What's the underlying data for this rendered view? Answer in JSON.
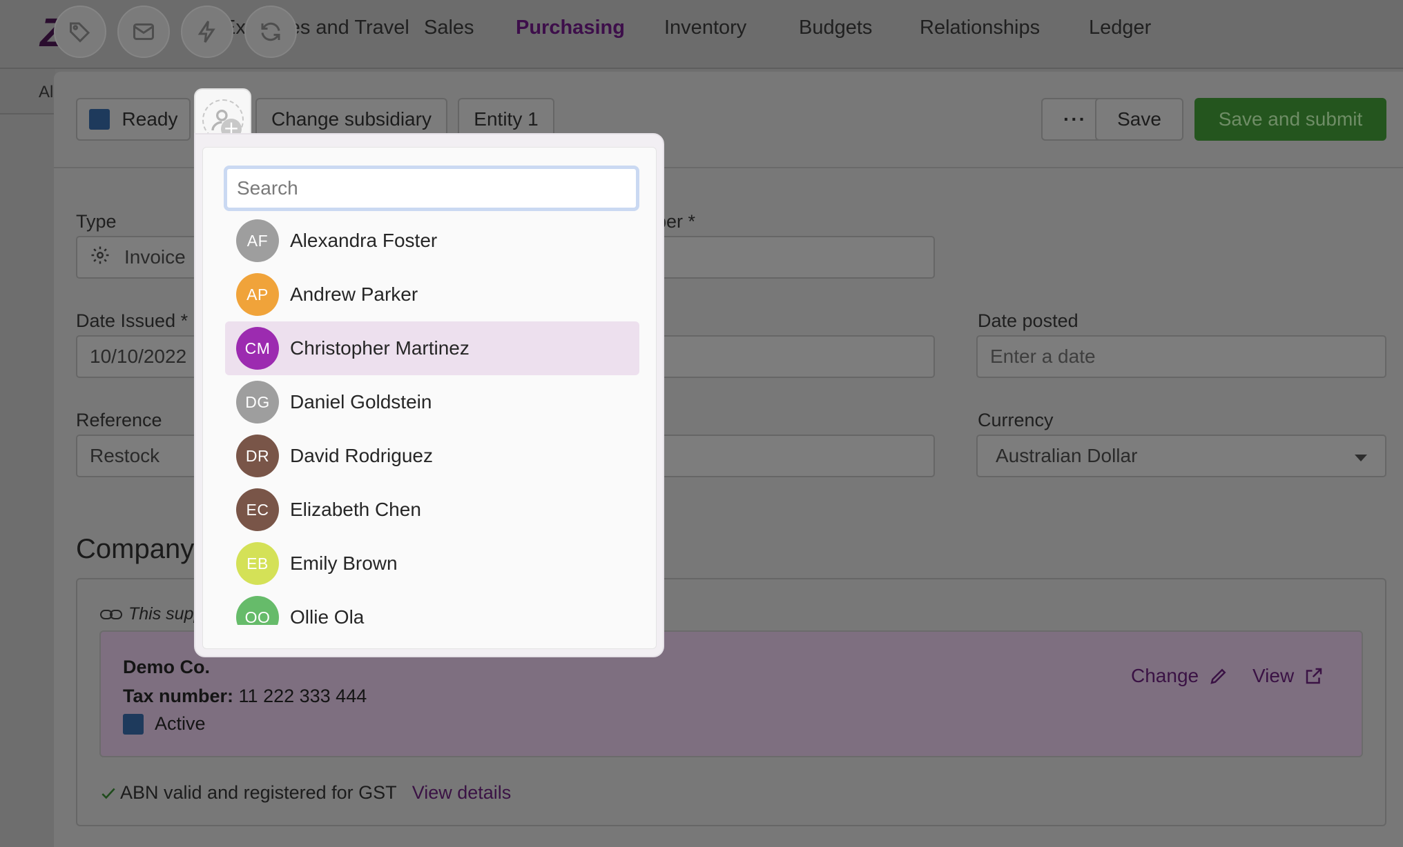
{
  "nav": {
    "logo": "Ze",
    "items": [
      {
        "label": "Expenses and Travel",
        "active": false
      },
      {
        "label": "Sales",
        "active": false
      },
      {
        "label": "Purchasing",
        "active": true
      },
      {
        "label": "Inventory",
        "active": false
      },
      {
        "label": "Budgets",
        "active": false
      },
      {
        "label": "Relationships",
        "active": false
      },
      {
        "label": "Ledger",
        "active": false
      }
    ],
    "quick_icons": [
      "tag-icon",
      "mail-icon",
      "lightning-icon",
      "refresh-icon"
    ]
  },
  "subnav": {
    "label": "Al"
  },
  "toolbar": {
    "status_label": "Ready",
    "change_subsidiary_label": "Change subsidiary",
    "entity_label": "Entity 1",
    "more_label": "···",
    "save_label": "Save",
    "save_submit_label": "Save and submit"
  },
  "form": {
    "type_label": "Type",
    "type_value": "Invoice",
    "number_label": "ber *",
    "date_issued_label": "Date Issued *",
    "date_issued_value": "10/10/2022",
    "date_posted_label": "Date posted",
    "date_posted_placeholder": "Enter a date",
    "reference_label": "Reference",
    "reference_value": "Restock",
    "currency_label": "Currency",
    "currency_value": "Australian Dollar"
  },
  "company": {
    "title": "Company",
    "note": "This supp",
    "supplier_name": "Demo Co.",
    "tax_label": "Tax number:",
    "tax_value": "11 222 333 444",
    "status": "Active",
    "change_label": "Change",
    "view_label": "View",
    "abn_text": "ABN valid and registered for GST",
    "view_details_label": "View details"
  },
  "assignee_dropdown": {
    "search_placeholder": "Search",
    "people": [
      {
        "initials": "AF",
        "name": "Alexandra Foster",
        "color": "#9e9e9e",
        "highlighted": false
      },
      {
        "initials": "AP",
        "name": "Andrew Parker",
        "color": "#f0a33a",
        "highlighted": false
      },
      {
        "initials": "CM",
        "name": "Christopher Martinez",
        "color": "#9c2bb0",
        "highlighted": true
      },
      {
        "initials": "DG",
        "name": "Daniel Goldstein",
        "color": "#9e9e9e",
        "highlighted": false
      },
      {
        "initials": "DR",
        "name": "David Rodriguez",
        "color": "#795548",
        "highlighted": false
      },
      {
        "initials": "EC",
        "name": "Elizabeth Chen",
        "color": "#795548",
        "highlighted": false
      },
      {
        "initials": "EB",
        "name": "Emily Brown",
        "color": "#d4e157",
        "highlighted": false
      },
      {
        "initials": "OO",
        "name": "Ollie Ola",
        "color": "#66bb6a",
        "highlighted": false
      }
    ]
  }
}
